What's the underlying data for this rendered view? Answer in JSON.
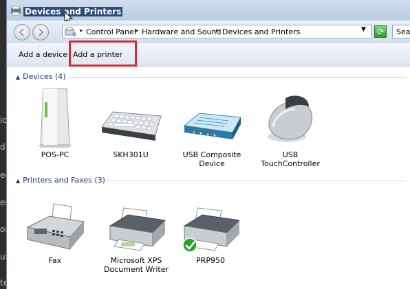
{
  "window": {
    "title": "Devices and Printers"
  },
  "address": {
    "breadcrumbs": [
      "Control Panel",
      "Hardware and Sound",
      "Devices and Printers"
    ],
    "search_placeholder": "Search"
  },
  "commands": {
    "add_device": "Add a device",
    "add_printer": "Add a printer"
  },
  "groups": {
    "devices": {
      "header": "Devices (4)",
      "items": [
        {
          "label": "POS-PC",
          "icon": "computer-icon"
        },
        {
          "label": "SKH301U",
          "icon": "keyboard-icon"
        },
        {
          "label": "USB Composite Device",
          "icon": "modem-icon"
        },
        {
          "label": "USB TouchController",
          "icon": "mouse-icon"
        }
      ]
    },
    "printers": {
      "header": "Printers and Faxes (3)",
      "items": [
        {
          "label": "Fax",
          "icon": "fax-icon"
        },
        {
          "label": "Microsoft XPS Document Writer",
          "icon": "printer-icon"
        },
        {
          "label": "PRP950",
          "icon": "printer-default-icon"
        }
      ]
    }
  },
  "desktop_fragments": [
    "ic",
    "d",
    "ed",
    "er",
    "on",
    "ur",
    "te"
  ],
  "colors": {
    "highlight": "#e3262b",
    "group_header": "#1e3287",
    "default_check": "#27a327"
  }
}
